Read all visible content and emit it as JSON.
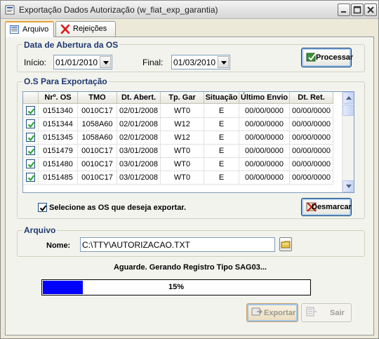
{
  "window": {
    "title": "Exportação Dados Autorização (w_fiat_exp_garantia)"
  },
  "tabs": [
    {
      "label": "Arquivo",
      "active": true
    },
    {
      "label": "Rejeições",
      "active": false
    }
  ],
  "period": {
    "group_title": "Data de Abertura da OS",
    "inicio_label": "Início:",
    "inicio_value": "01/01/2010",
    "final_label": "Final:",
    "final_value": "01/03/2010",
    "process_button": "Processar"
  },
  "os_table": {
    "group_title": "O.S  Para  Exportação",
    "columns": [
      "Nrº. OS",
      "TMO",
      "Dt.  Abert.",
      "Tp. Gar",
      "Situação",
      "Último Envio",
      "Dt. Ret."
    ],
    "rows": [
      {
        "checked": true,
        "os": "0151340",
        "tmo": "0010C17",
        "dt_abert": "02/01/2008",
        "tp_gar": "WT0",
        "situacao": "E",
        "ultimo_envio": "00/00/0000",
        "dt_ret": "00/00/0000"
      },
      {
        "checked": true,
        "os": "0151344",
        "tmo": "1058A60",
        "dt_abert": "02/01/2008",
        "tp_gar": "W12",
        "situacao": "E",
        "ultimo_envio": "00/00/0000",
        "dt_ret": "00/00/0000"
      },
      {
        "checked": true,
        "os": "0151345",
        "tmo": "1058A60",
        "dt_abert": "02/01/2008",
        "tp_gar": "W12",
        "situacao": "E",
        "ultimo_envio": "00/00/0000",
        "dt_ret": "00/00/0000"
      },
      {
        "checked": true,
        "os": "0151479",
        "tmo": "0010C17",
        "dt_abert": "03/01/2008",
        "tp_gar": "WT0",
        "situacao": "E",
        "ultimo_envio": "00/00/0000",
        "dt_ret": "00/00/0000"
      },
      {
        "checked": true,
        "os": "0151480",
        "tmo": "0010C17",
        "dt_abert": "03/01/2008",
        "tp_gar": "WT0",
        "situacao": "E",
        "ultimo_envio": "00/00/0000",
        "dt_ret": "00/00/0000"
      },
      {
        "checked": true,
        "os": "0151485",
        "tmo": "0010C17",
        "dt_abert": "03/01/2008",
        "tp_gar": "WT0",
        "situacao": "E",
        "ultimo_envio": "00/00/0000",
        "dt_ret": "00/00/0000"
      }
    ],
    "select_all_label": "Selecione as OS que deseja exportar.",
    "select_all_checked": true,
    "unmark_button": "Desmarcar"
  },
  "file": {
    "group_title": "Arquivo",
    "name_label": "Nome:",
    "name_value": "C:\\TTY\\AUTORIZACAO.TXT"
  },
  "status": {
    "message": "Aguarde. Gerando Registro Tipo SAG03...",
    "progress_percent": 15,
    "progress_label": "15%"
  },
  "actions": {
    "export_button": "Exportar",
    "exit_button": "Sair"
  },
  "colors": {
    "progress_fill": "#0000ff",
    "group_title": "#1f3a70",
    "tab_highlight": "#e9a03a"
  }
}
